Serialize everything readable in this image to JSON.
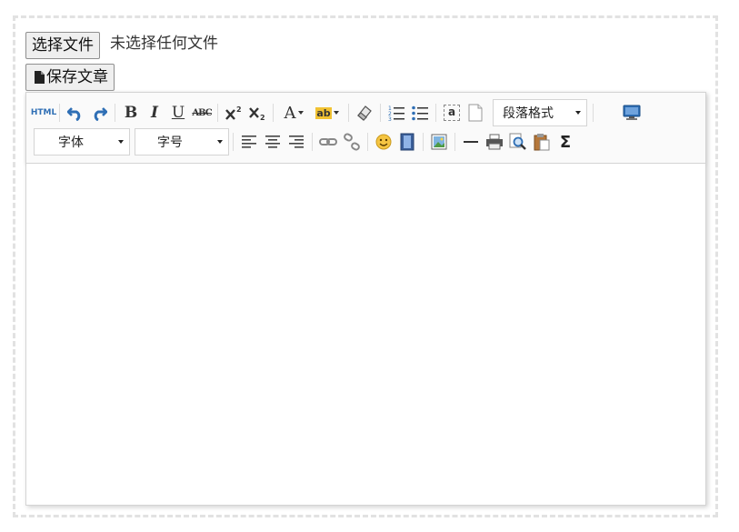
{
  "file_input": {
    "button_label": "选择文件",
    "status_text": "未选择任何文件"
  },
  "save_button": {
    "label": "保存文章",
    "icon": "document-icon"
  },
  "toolbar": {
    "html_label": "HTML",
    "paragraph_format": "段落格式",
    "font_family": "字体",
    "font_size": "字号",
    "bold": "B",
    "italic": "I",
    "underline": "U",
    "strike": "ABC",
    "text_color": "A",
    "highlight": "ab",
    "anchor": "a",
    "sigma": "Σ"
  },
  "colors": {
    "border": "#d4d4d4",
    "toolbar_bg": "#fafafa",
    "icon_blue": "#2f6fb5",
    "dashed": "#e2e2e2"
  }
}
